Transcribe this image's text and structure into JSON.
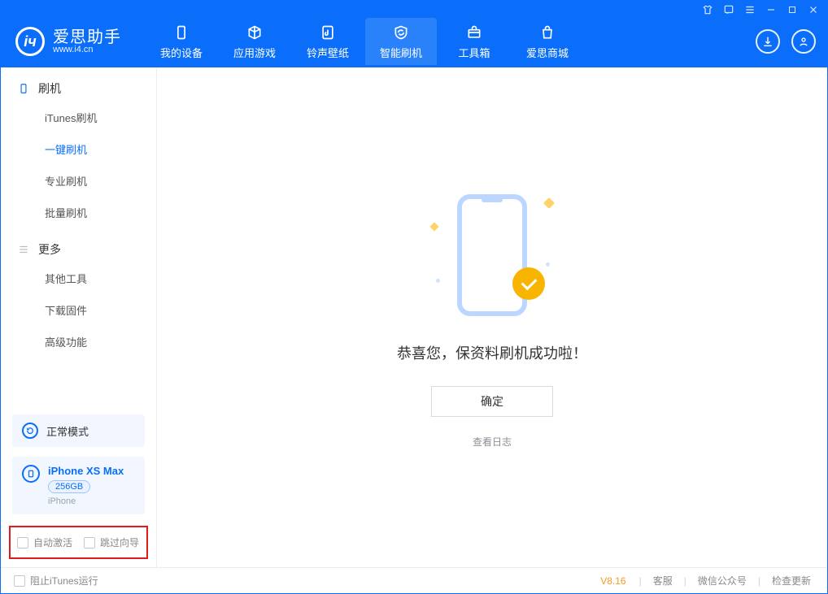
{
  "app": {
    "name_cn": "爱思助手",
    "name_en": "www.i4.cn"
  },
  "nav": {
    "items": [
      {
        "label": "我的设备"
      },
      {
        "label": "应用游戏"
      },
      {
        "label": "铃声壁纸"
      },
      {
        "label": "智能刷机"
      },
      {
        "label": "工具箱"
      },
      {
        "label": "爱思商城"
      }
    ]
  },
  "sidebar": {
    "section1": {
      "title": "刷机"
    },
    "items1": [
      {
        "label": "iTunes刷机"
      },
      {
        "label": "一键刷机"
      },
      {
        "label": "专业刷机"
      },
      {
        "label": "批量刷机"
      }
    ],
    "section2": {
      "title": "更多"
    },
    "items2": [
      {
        "label": "其他工具"
      },
      {
        "label": "下载固件"
      },
      {
        "label": "高级功能"
      }
    ],
    "mode_label": "正常模式",
    "device": {
      "name": "iPhone XS Max",
      "storage": "256GB",
      "type": "iPhone"
    },
    "bottom_opts": {
      "auto_activate": "自动激活",
      "skip_guide": "跳过向导"
    }
  },
  "main": {
    "success_text": "恭喜您，保资料刷机成功啦！",
    "ok_label": "确定",
    "view_log": "查看日志"
  },
  "footer": {
    "block_itunes": "阻止iTunes运行",
    "version": "V8.16",
    "links": {
      "support": "客服",
      "wechat": "微信公众号",
      "update": "检查更新"
    }
  }
}
